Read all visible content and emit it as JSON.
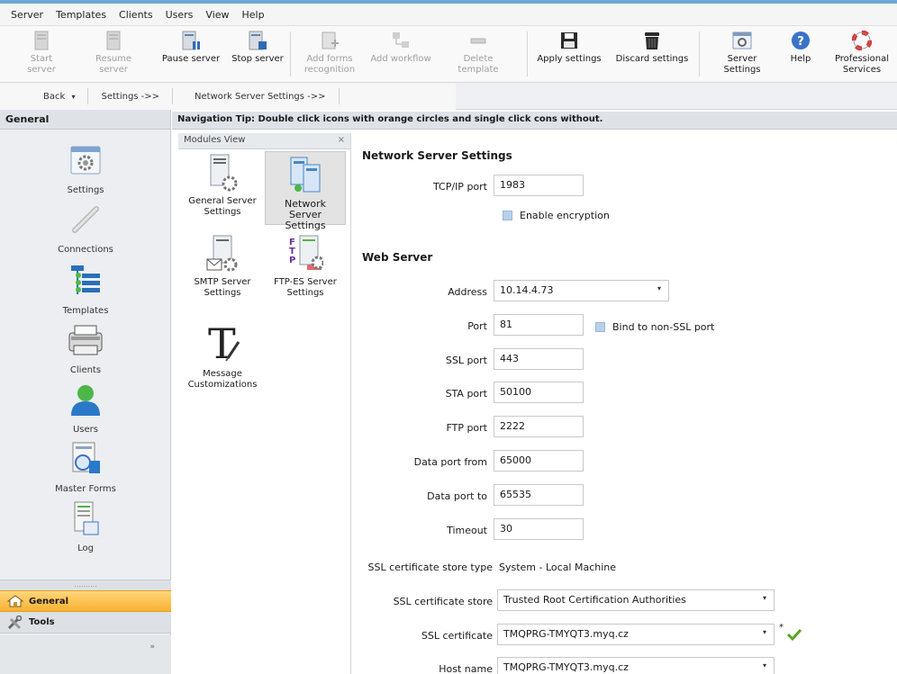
{
  "menu": [
    "Server",
    "Templates",
    "Clients",
    "Users",
    "View",
    "Help"
  ],
  "toolbar": {
    "start_server": "Start server",
    "resume_server": "Resume server",
    "pause_server": "Pause server",
    "stop_server": "Stop server",
    "add_forms_recognition": "Add forms recognition",
    "add_workflow": "Add workflow",
    "delete_template": "Delete template",
    "apply_settings": "Apply settings",
    "discard_settings": "Discard settings",
    "server_settings": "Server Settings",
    "help": "Help",
    "professional_services": "Professional Services"
  },
  "nav": {
    "back": "Back",
    "settings": "Settings ->>",
    "network_server_settings": "Network Server Settings ->>"
  },
  "left_panel": {
    "header": "General",
    "items": [
      "Settings",
      "Connections",
      "Templates",
      "Clients",
      "Users",
      "Master Forms",
      "Log"
    ],
    "tab_general": "General",
    "tab_tools": "Tools",
    "grip": "..........",
    "chevron": "»"
  },
  "tip": "Navigation Tip: Double click icons with orange circles and single click cons without.",
  "modules": {
    "title": "Modules View",
    "close": "×",
    "items": {
      "general": "General Server Settings",
      "network": "Network Server Settings",
      "smtp": "SMTP Server Settings",
      "ftp": "FTP-ES Server Settings",
      "message": "Message Customizations"
    }
  },
  "form": {
    "section_network": "Network Server Settings",
    "tcpip_label": "TCP/IP port",
    "tcpip_value": "1983",
    "enable_encryption": "Enable encryption",
    "section_web": "Web Server",
    "address_label": "Address",
    "address_value": "10.14.4.73",
    "port_label": "Port",
    "port_value": "81",
    "bind_label": "Bind to non-SSL port",
    "ssl_port_label": "SSL port",
    "ssl_port_value": "443",
    "sta_port_label": "STA port",
    "sta_port_value": "50100",
    "ftp_port_label": "FTP port",
    "ftp_port_value": "2222",
    "data_port_from_label": "Data port from",
    "data_port_from_value": "65000",
    "data_port_to_label": "Data port to",
    "data_port_to_value": "65535",
    "timeout_label": "Timeout",
    "timeout_value": "30",
    "ssl_store_type_label": "SSL certificate store type",
    "ssl_store_type_value": "System - Local Machine",
    "ssl_store_label": "SSL certificate store",
    "ssl_store_value": "Trusted Root Certification Authorities",
    "ssl_cert_label": "SSL certificate",
    "ssl_cert_value": "TMQPRG-TMYQT3.myq.cz",
    "host_label": "Host name",
    "host_value": "TMQPRG-TMYQT3.myq.cz",
    "required_marker": "*"
  },
  "colors": {
    "accent_orange": "#f8b133",
    "check_green": "#5aa526",
    "checkbox_blue": "#b9d0ea"
  }
}
